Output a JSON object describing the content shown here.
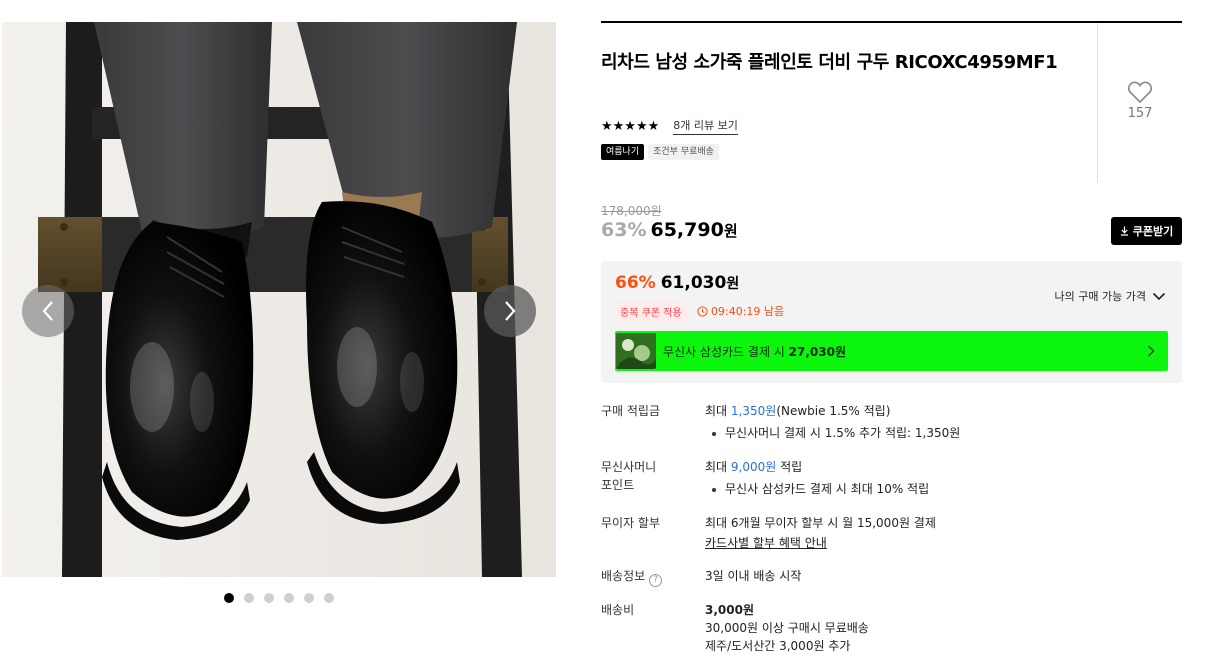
{
  "gallery": {
    "dot_count": 6,
    "active_index": 0
  },
  "product": {
    "title": "리차드 남성 소가죽 플레인토 더비 구두 RICOXC4959MF1",
    "stars": "★★★★★",
    "review_link": "8개 리뷰 보기",
    "tags": [
      "여름나기",
      "조건부 무료배송"
    ],
    "like_count": "157"
  },
  "price": {
    "original": "178,000원",
    "sale_pct": "63%",
    "sale_price": "65,790",
    "won": "원",
    "coupon_btn": "쿠폰받기"
  },
  "benefit": {
    "best_pct": "66%",
    "best_price": "61,030",
    "won": "원",
    "dup_tag": "중복 쿠폰 적용",
    "timer": "09:40:19 남음",
    "my_price": "나의 구매 가능 가격",
    "card_banner_prefix": "무신사 삼성카드 결제 시 ",
    "card_banner_amount": "27,030원",
    "colors": {
      "highlight": "#ff4e0a",
      "banner": "#0cf50c"
    }
  },
  "info": {
    "points": {
      "label": "구매 적립금",
      "prefix": "최대 ",
      "amount": "1,350원",
      "suffix": "(Newbie 1.5% 적립)",
      "bullet": "무신사머니 결제 시 1.5% 추가 적립: 1,350원"
    },
    "money_point": {
      "label_line1": "무신사머니",
      "label_line2": "포인트",
      "prefix": "최대 ",
      "amount": "9,000원",
      "suffix": " 적립",
      "bullet": "무신사 삼성카드 결제 시 최대 10% 적립"
    },
    "installment": {
      "label": "무이자 할부",
      "text": "최대 6개월 무이자 할부 시 월 15,000원 결제",
      "link": "카드사별 할부 혜택 안내"
    },
    "shipping_info": {
      "label": "배송정보",
      "help": "?",
      "text": "3일 이내 배송 시작"
    },
    "shipping_fee": {
      "label": "배송비",
      "fee": "3,000원",
      "line2": "30,000원 이상 구매시 무료배송",
      "line3": "제주/도서산간 3,000원 추가"
    }
  }
}
